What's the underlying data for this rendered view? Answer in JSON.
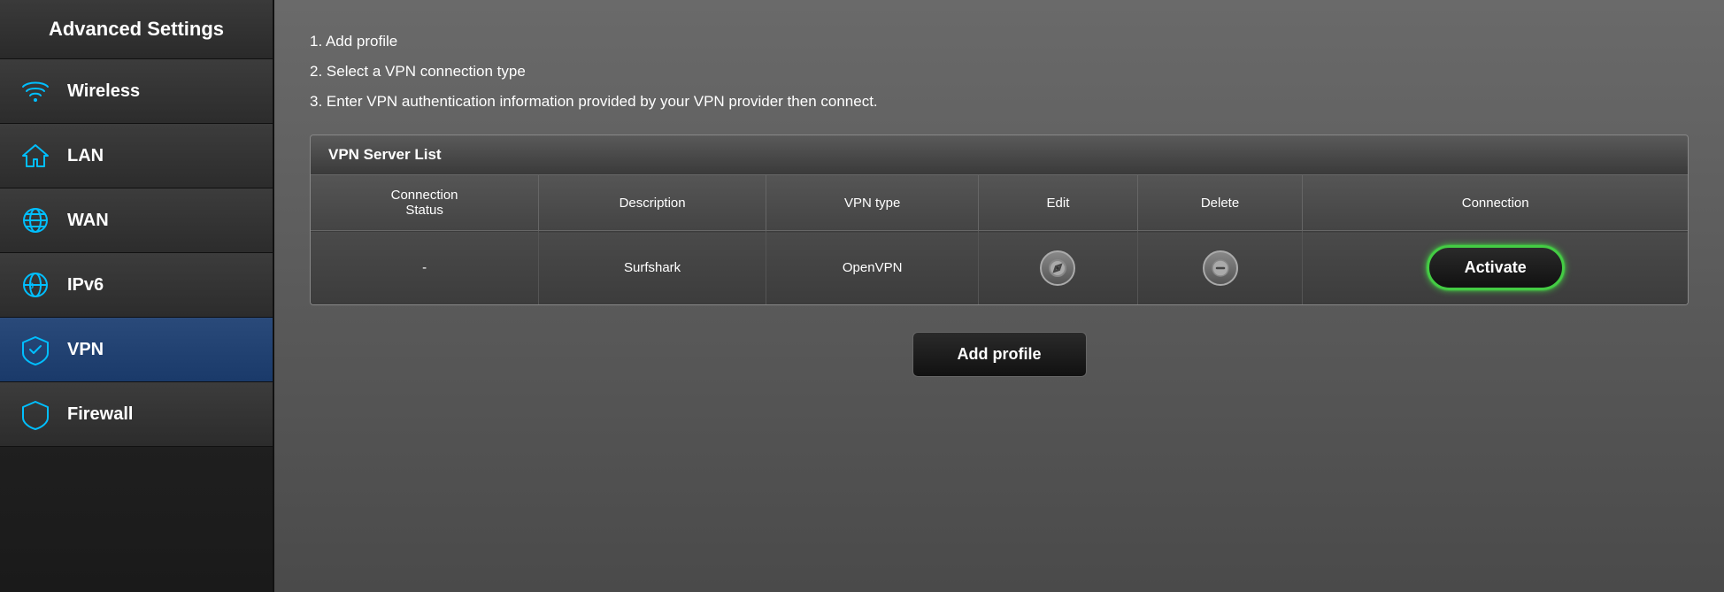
{
  "sidebar": {
    "title": "Advanced Settings",
    "items": [
      {
        "id": "wireless",
        "label": "Wireless",
        "icon": "wifi-icon",
        "active": false
      },
      {
        "id": "lan",
        "label": "LAN",
        "icon": "home-icon",
        "active": false
      },
      {
        "id": "wan",
        "label": "WAN",
        "icon": "globe-icon",
        "active": false
      },
      {
        "id": "ipv6",
        "label": "IPv6",
        "icon": "ipv6-icon",
        "active": false
      },
      {
        "id": "vpn",
        "label": "VPN",
        "icon": "vpn-icon",
        "active": true
      },
      {
        "id": "firewall",
        "label": "Firewall",
        "icon": "shield-icon",
        "active": false
      }
    ]
  },
  "main": {
    "instructions": [
      "1. Add profile",
      "2. Select a VPN connection type",
      "3. Enter VPN authentication information provided by your VPN provider then connect."
    ],
    "vpn_table": {
      "title": "VPN Server List",
      "columns": [
        "Connection\nStatus",
        "Description",
        "VPN type",
        "Edit",
        "Delete",
        "Connection"
      ],
      "rows": [
        {
          "status": "-",
          "description": "Surfshark",
          "vpn_type": "OpenVPN",
          "connection": "Activate"
        }
      ]
    },
    "add_profile_label": "Add profile"
  }
}
